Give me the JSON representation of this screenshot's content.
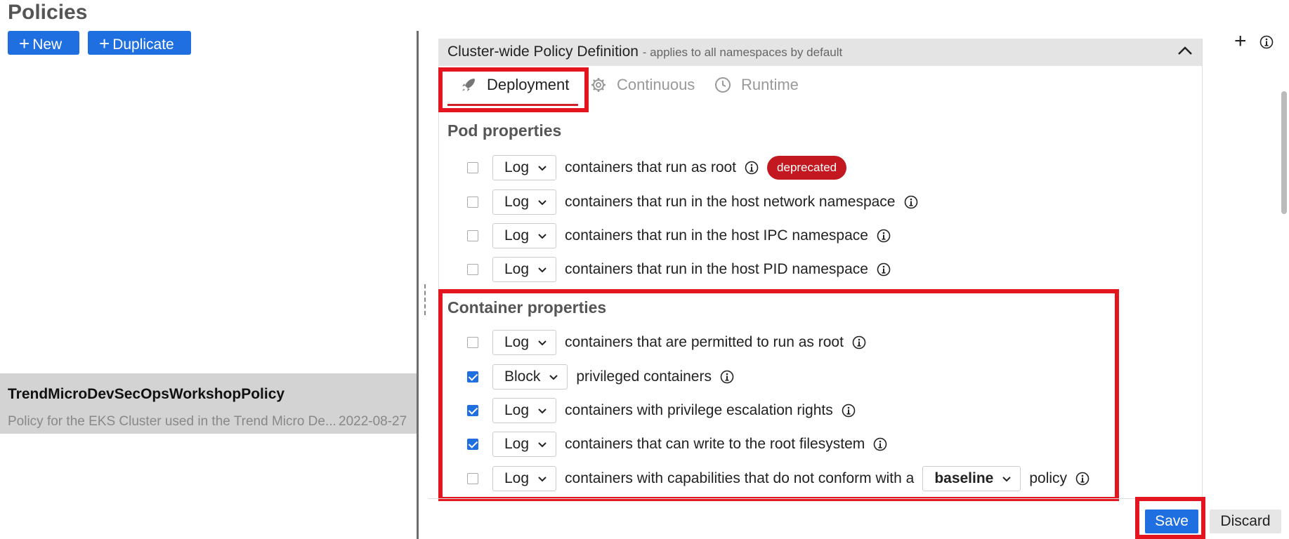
{
  "header": {
    "title": "Policies"
  },
  "toolbar": {
    "new_label": "New",
    "duplicate_label": "Duplicate"
  },
  "policy_list": [
    {
      "name": "TrendMicroDevSecOpsWorkshopPolicy",
      "description": "Policy for the EKS Cluster used in the Trend Micro De...",
      "date": "2022-08-27"
    }
  ],
  "panel": {
    "title": "Cluster-wide Policy Definition",
    "subtitle": "- applies to all namespaces by default",
    "tabs": [
      {
        "label": "Deployment",
        "icon": "rocket-icon",
        "active": true
      },
      {
        "label": "Continuous",
        "icon": "gear-icon",
        "active": false
      },
      {
        "label": "Runtime",
        "icon": "clock-icon",
        "active": false
      }
    ]
  },
  "pod_properties": {
    "title": "Pod properties",
    "rows": [
      {
        "checked": false,
        "action": "Log",
        "text": "containers that run as root",
        "badge": "deprecated"
      },
      {
        "checked": false,
        "action": "Log",
        "text": "containers that run in the host network namespace"
      },
      {
        "checked": false,
        "action": "Log",
        "text": "containers that run in the host IPC namespace"
      },
      {
        "checked": false,
        "action": "Log",
        "text": "containers that run in the host PID namespace"
      }
    ]
  },
  "container_properties": {
    "title": "Container properties",
    "rows": [
      {
        "checked": false,
        "action": "Log",
        "text": "containers that are permitted to run as root"
      },
      {
        "checked": true,
        "action": "Block",
        "text": "privileged containers"
      },
      {
        "checked": true,
        "action": "Log",
        "text": "containers with privilege escalation rights"
      },
      {
        "checked": true,
        "action": "Log",
        "text": "containers that can write to the root filesystem"
      },
      {
        "checked": false,
        "action": "Log",
        "text": "containers with capabilities that do not conform with a",
        "extra_select": "baseline",
        "suffix": "policy"
      }
    ]
  },
  "footer": {
    "save_label": "Save",
    "discard_label": "Discard"
  },
  "colors": {
    "accent": "#1f6fe0",
    "highlight": "#e3161f",
    "badge": "#c3181f"
  }
}
